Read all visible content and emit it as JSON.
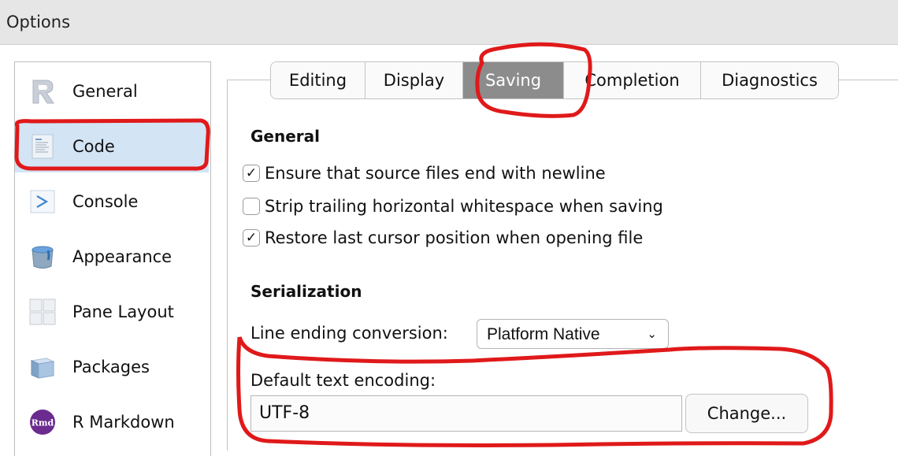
{
  "window": {
    "title": "Options"
  },
  "sidebar": {
    "items": [
      {
        "label": "General",
        "icon": "r-logo-icon",
        "selected": false
      },
      {
        "label": "Code",
        "icon": "code-document-icon",
        "selected": true
      },
      {
        "label": "Console",
        "icon": "console-prompt-icon",
        "selected": false
      },
      {
        "label": "Appearance",
        "icon": "paint-bucket-icon",
        "selected": false
      },
      {
        "label": "Pane Layout",
        "icon": "pane-grid-icon",
        "selected": false
      },
      {
        "label": "Packages",
        "icon": "package-box-icon",
        "selected": false
      },
      {
        "label": "R Markdown",
        "icon": "rmd-badge-icon",
        "selected": false
      }
    ],
    "rmd_badge_text": "Rmd"
  },
  "tabs": [
    {
      "label": "Editing",
      "active": false
    },
    {
      "label": "Display",
      "active": false
    },
    {
      "label": "Saving",
      "active": true
    },
    {
      "label": "Completion",
      "active": false
    },
    {
      "label": "Diagnostics",
      "active": false
    }
  ],
  "general": {
    "title": "General",
    "options": [
      {
        "label": "Ensure that source files end with newline",
        "checked": true
      },
      {
        "label": "Strip trailing horizontal whitespace when saving",
        "checked": false
      },
      {
        "label": "Restore last cursor position when opening file",
        "checked": true
      }
    ]
  },
  "serialization": {
    "title": "Serialization",
    "line_ending_label": "Line ending conversion:",
    "line_ending_value": "Platform Native",
    "encoding_label": "Default text encoding:",
    "encoding_value": "UTF-8",
    "change_label": "Change..."
  },
  "colors": {
    "selected_row": "#d3e4f4",
    "active_tab": "#8c8c8c",
    "annotation": "#e0191a"
  }
}
